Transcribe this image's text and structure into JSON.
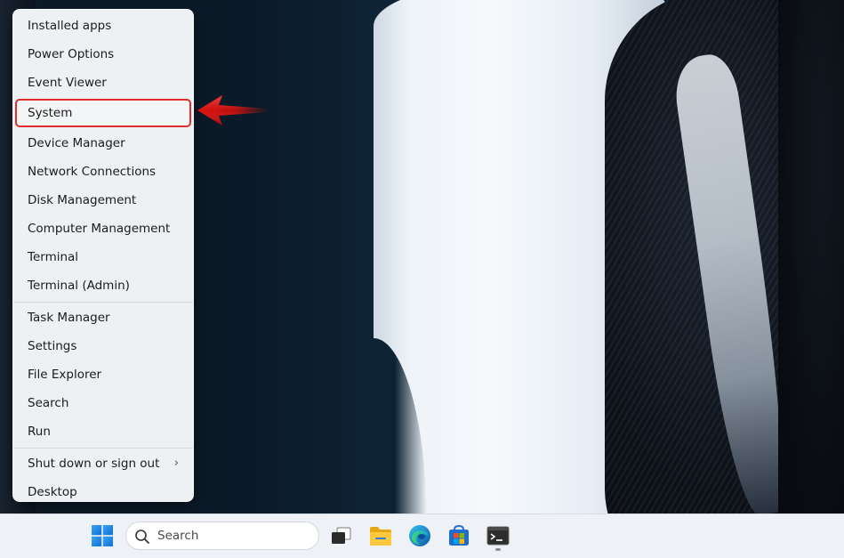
{
  "context_menu": {
    "group1": [
      {
        "label": "Installed apps"
      },
      {
        "label": "Power Options"
      },
      {
        "label": "Event Viewer"
      },
      {
        "label": "System"
      },
      {
        "label": "Device Manager"
      },
      {
        "label": "Network Connections"
      },
      {
        "label": "Disk Management"
      },
      {
        "label": "Computer Management"
      },
      {
        "label": "Terminal"
      },
      {
        "label": "Terminal (Admin)"
      }
    ],
    "group2": [
      {
        "label": "Task Manager"
      },
      {
        "label": "Settings"
      },
      {
        "label": "File Explorer"
      },
      {
        "label": "Search"
      },
      {
        "label": "Run"
      }
    ],
    "group3": [
      {
        "label": "Shut down or sign out",
        "chevron": "›"
      },
      {
        "label": "Desktop"
      }
    ],
    "highlighted_item": "System",
    "highlight_color": "#e22d2d"
  },
  "annotation": {
    "arrow_color": "#d41818",
    "points_to": "System"
  },
  "taskbar": {
    "search_label": "Search",
    "icons": [
      "windows-start-icon",
      "task-view-icon",
      "file-explorer-icon",
      "edge-browser-icon",
      "microsoft-store-icon",
      "terminal-icon"
    ]
  }
}
